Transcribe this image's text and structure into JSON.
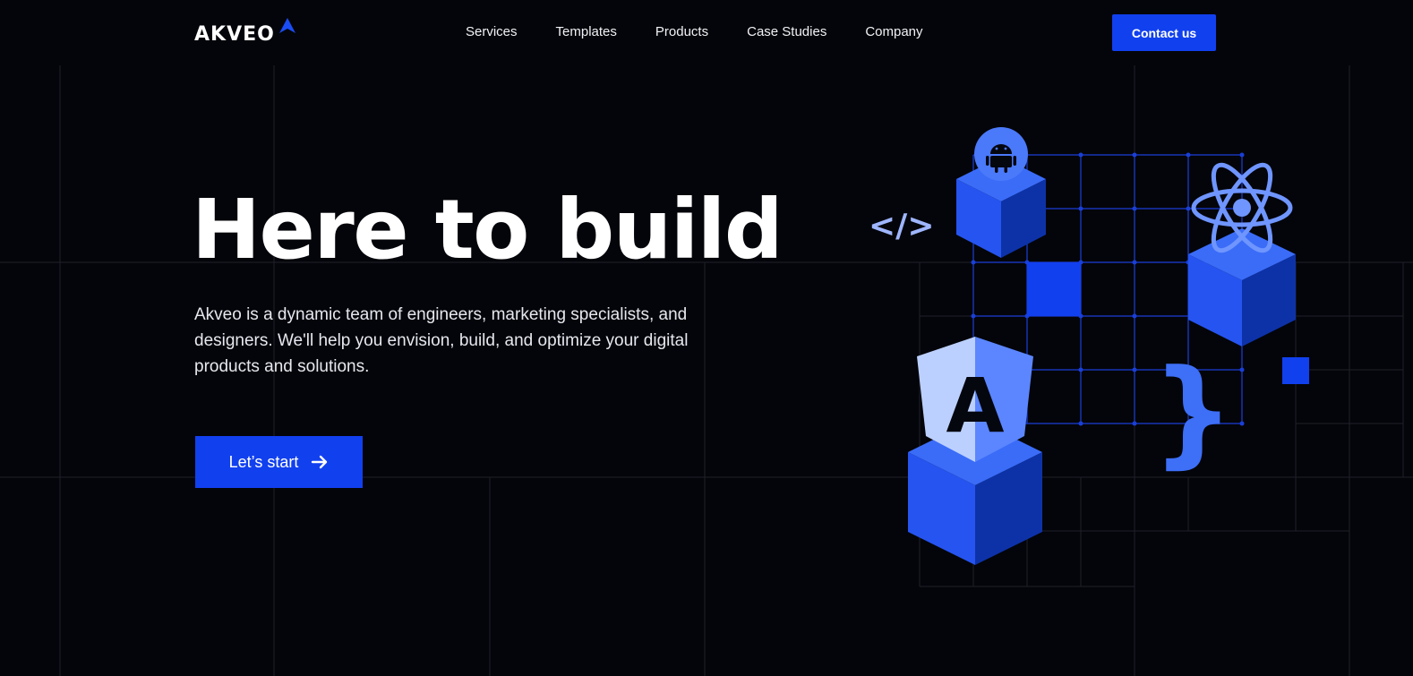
{
  "brand": {
    "name": "AKVEO"
  },
  "nav": {
    "items": [
      {
        "label": "Services"
      },
      {
        "label": "Templates"
      },
      {
        "label": "Products"
      },
      {
        "label": "Case Studies"
      },
      {
        "label": "Company"
      }
    ],
    "contact_label": "Contact us"
  },
  "hero": {
    "title": "Here to build",
    "description": "Akveo is a dynamic team of engineers, marketing specialists, and designers. We'll help you envision, build, and optimize your digital products and solutions.",
    "cta_label": "Let’s start"
  },
  "illustration": {
    "code_glyph": "</>",
    "brace_glyph": "}",
    "angular_letter": "A"
  },
  "colors": {
    "background": "#04050a",
    "accent": "#1140ef",
    "cube_light": "#2a5cf5",
    "cube_dark": "#0d32a8",
    "icon_light": "#6f95ff",
    "grid_line": "#22242c"
  },
  "icons": [
    "logo-triangle-icon",
    "arrow-right-icon",
    "android-icon",
    "react-icon",
    "angular-icon",
    "code-tag-icon",
    "curly-brace-icon"
  ]
}
